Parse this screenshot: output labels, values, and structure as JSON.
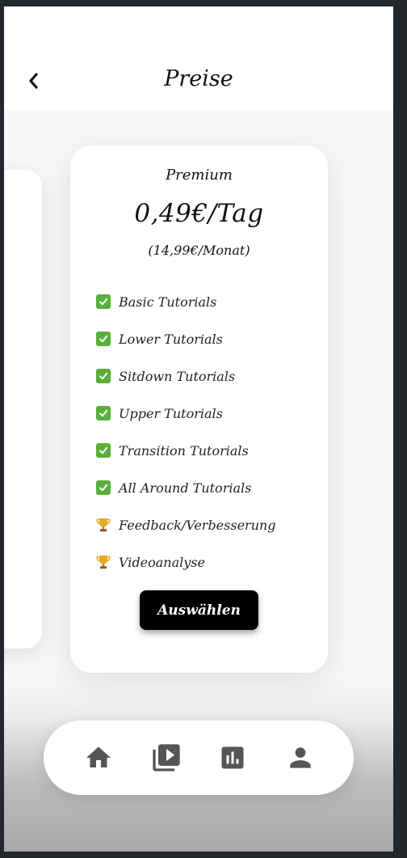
{
  "header": {
    "title": "Preise"
  },
  "plan": {
    "name": "Premium",
    "price": "0,49€/Tag",
    "subprice": "(14,99€/Monat)",
    "features": [
      {
        "icon": "check-icon",
        "label": "Basic Tutorials"
      },
      {
        "icon": "check-icon",
        "label": "Lower Tutorials"
      },
      {
        "icon": "check-icon",
        "label": "Sitdown Tutorials"
      },
      {
        "icon": "check-icon",
        "label": "Upper Tutorials"
      },
      {
        "icon": "check-icon",
        "label": "Transition Tutorials"
      },
      {
        "icon": "check-icon",
        "label": "All Around Tutorials"
      },
      {
        "icon": "trophy-icon",
        "label": "Feedback/Verbesserung"
      },
      {
        "icon": "trophy-icon",
        "label": "Videoanalyse"
      }
    ],
    "button_label": "Auswählen"
  },
  "nav": {
    "items": [
      {
        "icon": "home-icon"
      },
      {
        "icon": "video-library-icon"
      },
      {
        "icon": "bar-chart-icon"
      },
      {
        "icon": "profile-icon"
      }
    ]
  },
  "colors": {
    "accent": "#000000",
    "check": "#5aae3c",
    "trophy": "#e0a32a",
    "nav_icon": "#555555"
  }
}
